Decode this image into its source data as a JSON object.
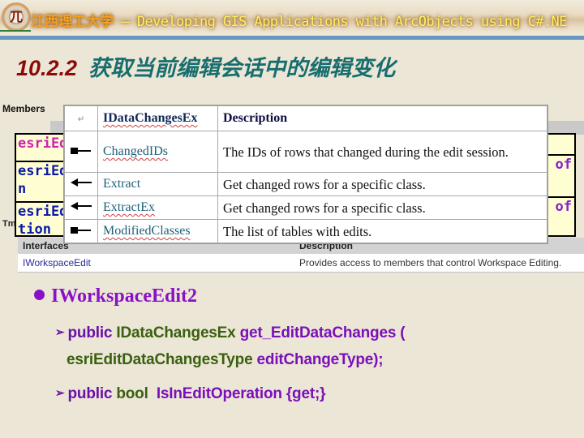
{
  "header": {
    "logo_glyph": "兀",
    "university": "江西理工大学",
    "separator": " — ",
    "course_title": "Developing GIS Applications with ArcObjects using C#.NE"
  },
  "section": {
    "number": "10.2.2",
    "title": "获取当前编辑会话中的编辑变化"
  },
  "background_doc": {
    "members_label": "Members",
    "tm_label": "Tm",
    "left_cells": [
      {
        "text": "esriEd",
        "color": "#d020b0"
      },
      {
        "text": "esriEd\nn",
        "color": "#0a1aa8"
      },
      {
        "text": "esriEd\ntion",
        "color": "#0a1aa8"
      }
    ],
    "right_cells": [
      {
        "text": ""
      },
      {
        "text": "t of"
      },
      {
        "text": "t of"
      }
    ],
    "interfaces_header": {
      "name": "Interfaces",
      "description": "Description"
    },
    "interfaces_rows": [
      {
        "name": "IWorkspaceEdit",
        "description": "Provides access to members that control Workspace Editing."
      }
    ]
  },
  "members_table": {
    "header": {
      "icon_mark": "↵",
      "name": "IDataChangesEx",
      "description": "Description"
    },
    "rows": [
      {
        "icon": "property-icon",
        "name": "ChangedIDs",
        "description": "The IDs of rows that changed during the edit session."
      },
      {
        "icon": "method-icon",
        "name": "Extract",
        "description": "Get changed rows for a specific class."
      },
      {
        "icon": "method-icon",
        "name": "ExtractEx",
        "description": "Get changed rows for a specific class."
      },
      {
        "icon": "property-icon",
        "name": "ModifiedClasses",
        "description": "The list of tables with edits."
      }
    ]
  },
  "bullets": {
    "main": "IWorkspaceEdit2",
    "lines": [
      {
        "arrow": "➢",
        "kw": "public",
        "type": "IDataChangesEx",
        "fn": "get_EditDataChanges (",
        "cont_type": "esriEditDataChangesType",
        "cont_fn": "editChangeType);"
      },
      {
        "arrow": "➢",
        "kw": "public",
        "type": "bool",
        "fn": "IsInEditOperation {get;}"
      }
    ]
  },
  "colors": {
    "background": "#ece6d6",
    "section_number": "#8b0b0b",
    "section_title": "#186e6e",
    "bullet_purple": "#8a10c8",
    "type_green": "#3a6010",
    "blue_rule": "#6a97c2"
  }
}
